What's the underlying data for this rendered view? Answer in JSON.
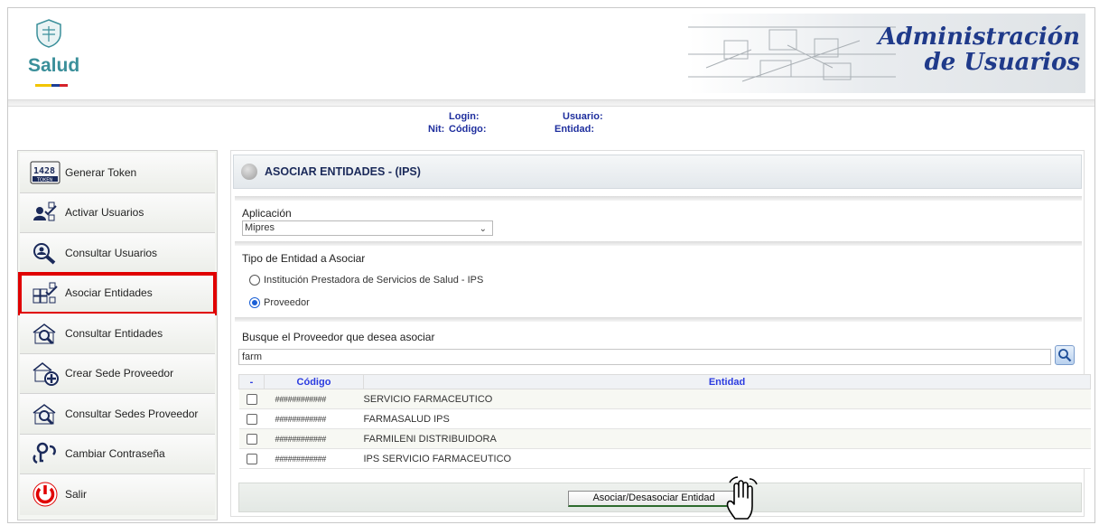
{
  "header": {
    "logo_text": "Salud",
    "banner_title_line1": "Administración",
    "banner_title_line2": "de Usuarios"
  },
  "userinfo": {
    "login_label": "Login:",
    "usuario_label": "Usuario:",
    "nit_label": "Nit:",
    "codigo_label": "Código:",
    "entidad_label": "Entidad:"
  },
  "sidebar": {
    "items": [
      {
        "label": "Generar Token",
        "icon": "token-icon"
      },
      {
        "label": "Activar Usuarios",
        "icon": "activate-users-icon"
      },
      {
        "label": "Consultar Usuarios",
        "icon": "search-users-icon"
      },
      {
        "label": "Asociar Entidades",
        "icon": "associate-entities-icon",
        "selected": true
      },
      {
        "label": "Consultar Entidades",
        "icon": "search-entities-icon"
      },
      {
        "label": "Crear Sede Proveedor",
        "icon": "create-site-icon"
      },
      {
        "label": "Consultar Sedes Proveedor",
        "icon": "search-sites-icon"
      },
      {
        "label": "Cambiar Contraseña",
        "icon": "change-password-icon"
      },
      {
        "label": "Salir",
        "icon": "power-icon"
      }
    ]
  },
  "main": {
    "title": "ASOCIAR ENTIDADES - (IPS)",
    "aplicacion_label": "Aplicación",
    "aplicacion_value": "Mipres",
    "tipo_label": "Tipo de Entidad a Asociar",
    "radio_ips": "Institución Prestadora de Servicios de Salud - IPS",
    "radio_proveedor": "Proveedor",
    "busque_label": "Busque el Proveedor que desea asociar",
    "search_value": "farm",
    "table": {
      "headers": [
        "-",
        "Código",
        "Entidad"
      ],
      "rows": [
        {
          "code": "############",
          "entity": "SERVICIO FARMACEUTICO"
        },
        {
          "code": "############",
          "entity": "FARMASALUD IPS"
        },
        {
          "code": "############",
          "entity": "FARMILENI DISTRIBUIDORA"
        },
        {
          "code": "############",
          "entity": "IPS SERVICIO FARMACEUTICO"
        }
      ]
    },
    "action_button": "Asociar/Desasociar Entidad"
  },
  "colors": {
    "accent_blue": "#1f3a8a",
    "selection_red": "#e00000",
    "header_text_blue": "#2b3be0"
  }
}
